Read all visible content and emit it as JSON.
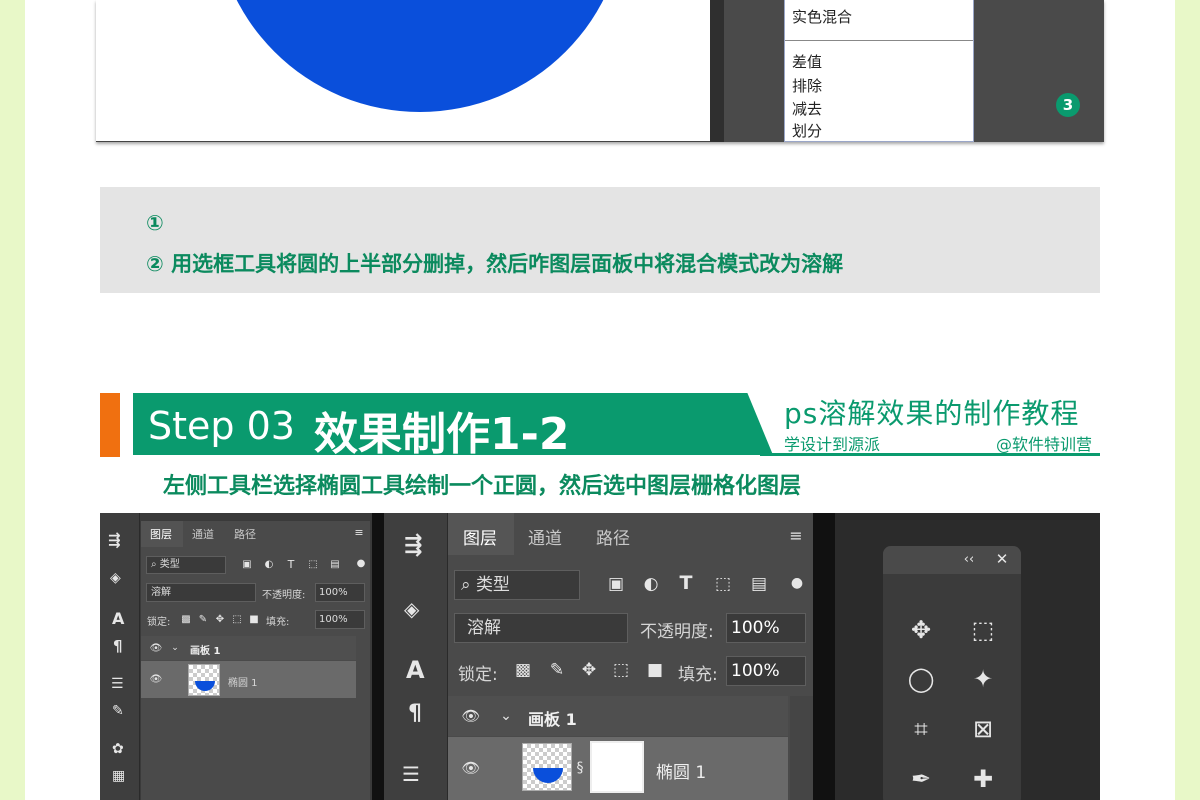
{
  "top_panel": {
    "blend_items_upper": [
      "实色混合"
    ],
    "blend_items_lower": [
      "差值",
      "排除",
      "减去",
      "划分"
    ],
    "badge": "3"
  },
  "note": {
    "line1": "①",
    "line2": "② 用选框工具将圆的上半部分删掉，然后咋图层面板中将混合模式改为溶解"
  },
  "step": {
    "number": "Step 03",
    "title": "效果制作1-2",
    "right_title": "ps溶解效果的制作教程",
    "sub_left": "学设计到源派",
    "sub_right": "@软件特训营"
  },
  "instruction": "左侧工具栏选择椭圆工具绘制一个正圆，然后选中图层栅格化图层",
  "layers_small": {
    "tabs": [
      "图层",
      "通道",
      "路径"
    ],
    "filter": "类型",
    "blend_mode": "溶解",
    "opacity_label": "不透明度:",
    "opacity_value": "100%",
    "lock_label": "锁定:",
    "fill_label": "填充:",
    "fill_value": "100%",
    "group_name": "画板 1",
    "layer_name": "椭圆 1"
  },
  "layers_large": {
    "tabs": [
      "图层",
      "通道",
      "路径"
    ],
    "filter": "类型",
    "blend_mode": "溶解",
    "opacity_label": "不透明度:",
    "opacity_value": "100%",
    "lock_label": "锁定:",
    "fill_label": "填充:",
    "fill_value": "100%",
    "group_name": "画板 1",
    "layer_name": "椭圆 1"
  },
  "colors": {
    "accent_green": "#0a9a6e",
    "accent_orange": "#f07010",
    "circle_blue": "#0a4fdb"
  }
}
